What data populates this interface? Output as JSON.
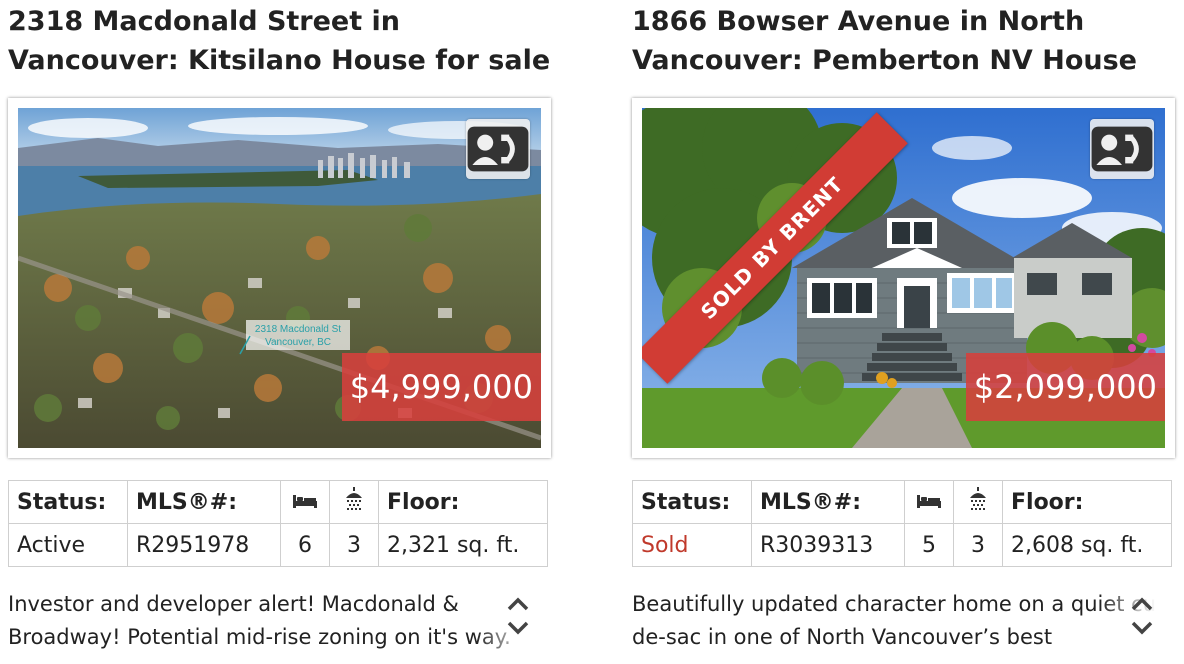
{
  "listings": [
    {
      "title": "2318 Macdonald Street in Vancouver: Kitsilano House for sale (Vancouver",
      "price": "$4,999,000",
      "photo_caption_line1": "2318 Macdonald St",
      "photo_caption_line2": "Vancouver, BC",
      "contact_icon": "contact-card-icon",
      "headers": {
        "status": "Status:",
        "mls": "MLS®#:",
        "floor": "Floor:"
      },
      "status": "Active",
      "mls": "R2951978",
      "beds": "6",
      "baths": "3",
      "floor": "2,321 sq. ft.",
      "description": "Investor and developer alert! Macdonald & Broadway! Potential mid-rise zoning on it's way."
    },
    {
      "title": "1866 Bowser Avenue in North Vancouver: Pemberton NV House for",
      "price": "$2,099,000",
      "ribbon": "SOLD BY BRENT",
      "contact_icon": "contact-card-icon",
      "headers": {
        "status": "Status:",
        "mls": "MLS®#:",
        "floor": "Floor:"
      },
      "status": "Sold",
      "mls": "R3039313",
      "beds": "5",
      "baths": "3",
      "floor": "2,608 sq. ft.",
      "description": "Beautifully updated character home on a quiet cul-de-sac in one of North Vancouver’s best"
    }
  ],
  "colors": {
    "price_bg": "#d6403c",
    "sold_text": "#c0392b",
    "ribbon": "#d13c34"
  }
}
